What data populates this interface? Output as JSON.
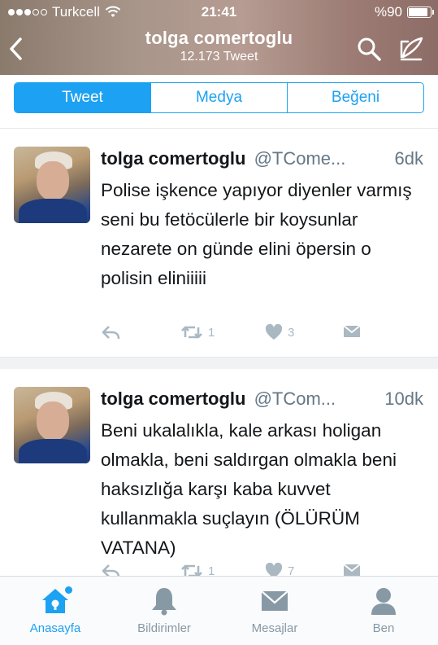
{
  "status_bar": {
    "carrier": "Turkcell",
    "time": "21:41",
    "battery": "%90",
    "battery_level": 0.9
  },
  "profile_header": {
    "name": "tolga comertoglu",
    "tweet_count": "12.173 Tweet",
    "back_icon": "chevron-left-icon",
    "search_icon": "search-icon",
    "compose_icon": "compose-icon"
  },
  "segments": {
    "tweet": "Tweet",
    "media": "Medya",
    "likes": "Beğeni",
    "selected": "Tweet"
  },
  "tweets": [
    {
      "author": "tolga comertoglu",
      "handle": "@TCome...",
      "age": "6dk",
      "text": "Polise  işkence yapıyor diyenler varmış seni bu fetöcülerle bir koysunlar nezarete on günde elini öpersin o polisin eliniiiii",
      "retweets": "1",
      "likes": "3"
    },
    {
      "author": "tolga comertoglu",
      "handle": "@TCom...",
      "age": "10dk",
      "text": "Beni ukalalıkla, kale arkası holigan olmakla, beni saldırgan olmakla beni haksızlığa karşı kaba kuvvet kullanmakla suçlayın (ÖLÜRÜM VATANA)",
      "retweets": "1",
      "likes": "7"
    }
  ],
  "tab_bar": {
    "home": "Anasayfa",
    "notifications": "Bildirimler",
    "messages": "Mesajlar",
    "me": "Ben",
    "active": "Anasayfa"
  },
  "colors": {
    "accent": "#1da1f2",
    "muted": "#657786",
    "icon_gray": "#aab8c2"
  }
}
